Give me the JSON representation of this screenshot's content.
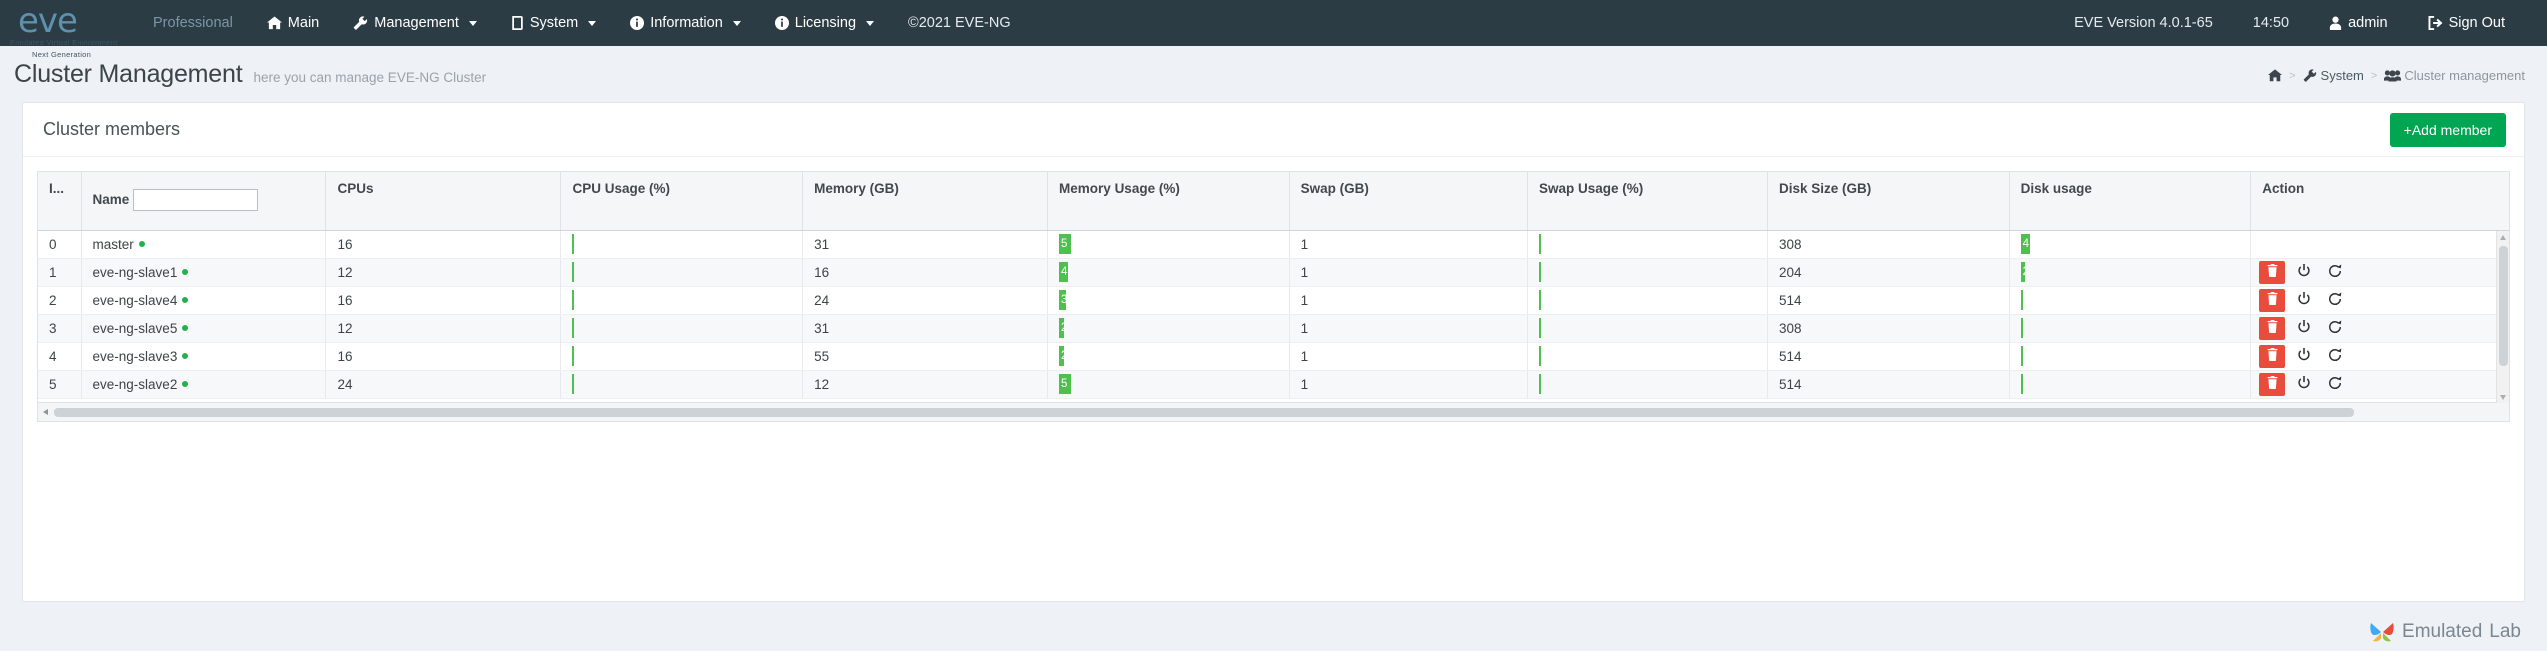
{
  "navbar": {
    "logo": {
      "text": "eve",
      "sub1": "Emulated Virtual Environment",
      "sub2": "Next Generation"
    },
    "items": [
      {
        "label": "Professional",
        "icon": "",
        "caret": false,
        "muted": true
      },
      {
        "label": "Main",
        "icon": "home-icon",
        "caret": false,
        "muted": false
      },
      {
        "label": "Management",
        "icon": "wrench-icon",
        "caret": true,
        "muted": false
      },
      {
        "label": "System",
        "icon": "book-icon",
        "caret": true,
        "muted": false
      },
      {
        "label": "Information",
        "icon": "info-icon",
        "caret": true,
        "muted": false
      },
      {
        "label": "Licensing",
        "icon": "info-icon",
        "caret": true,
        "muted": false
      },
      {
        "label": "©2021 EVE-NG",
        "icon": "",
        "caret": false,
        "muted": false
      }
    ],
    "version": "EVE Version 4.0.1-65",
    "time": "14:50",
    "user": "admin",
    "signout": "Sign Out",
    "user_icon": "user-icon",
    "signout_icon": "sign-out-icon"
  },
  "page": {
    "title": "Cluster Management",
    "subtitle": "here you can manage EVE-NG Cluster",
    "breadcrumb": {
      "home_icon": "home-icon",
      "sep": ">",
      "system": "System",
      "system_icon": "wrench-icon",
      "current": "Cluster management",
      "current_icon": "users-icon"
    }
  },
  "card": {
    "title": "Cluster members",
    "add_button": "+Add member"
  },
  "table": {
    "columns": [
      "I...",
      "Name",
      "CPUs",
      "CPU Usage (%)",
      "Memory (GB)",
      "Memory Usage (%)",
      "Swap (GB)",
      "Swap Usage (%)",
      "Disk Size (GB)",
      "Disk usage",
      "Action"
    ],
    "name_filter_value": "",
    "name_filter_placeholder": "",
    "rows": [
      {
        "id": "0",
        "name": "master",
        "status": "online",
        "cpus": "16",
        "cpu_usage": "0",
        "cpu_usage_pct": 0.4,
        "memory": "31",
        "memory_usage": "5",
        "memory_usage_pct": 5,
        "swap": "1",
        "swap_usage": "0",
        "swap_usage_pct": 0,
        "disk_size": "308",
        "disk_usage": "4",
        "disk_usage_pct": 4,
        "actions": []
      },
      {
        "id": "1",
        "name": "eve-ng-slave1",
        "status": "online",
        "cpus": "12",
        "cpu_usage": "0",
        "cpu_usage_pct": 0.5,
        "memory": "16",
        "memory_usage": "4",
        "memory_usage_pct": 4,
        "swap": "1",
        "swap_usage": "0",
        "swap_usage_pct": 0,
        "disk_size": "204",
        "disk_usage": "2",
        "disk_usage_pct": 2,
        "actions": [
          "delete",
          "power",
          "reload"
        ]
      },
      {
        "id": "2",
        "name": "eve-ng-slave4",
        "status": "online",
        "cpus": "16",
        "cpu_usage": "0",
        "cpu_usage_pct": 0.4,
        "memory": "24",
        "memory_usage": "3",
        "memory_usage_pct": 3,
        "swap": "1",
        "swap_usage": "0",
        "swap_usage_pct": 0,
        "disk_size": "514",
        "disk_usage": "1",
        "disk_usage_pct": 1,
        "actions": [
          "delete",
          "power",
          "reload"
        ]
      },
      {
        "id": "3",
        "name": "eve-ng-slave5",
        "status": "online",
        "cpus": "12",
        "cpu_usage": "0",
        "cpu_usage_pct": 0.4,
        "memory": "31",
        "memory_usage": "2",
        "memory_usage_pct": 2,
        "swap": "1",
        "swap_usage": "0",
        "swap_usage_pct": 0,
        "disk_size": "308",
        "disk_usage": "1",
        "disk_usage_pct": 1,
        "actions": [
          "delete",
          "power",
          "reload"
        ]
      },
      {
        "id": "4",
        "name": "eve-ng-slave3",
        "status": "online",
        "cpus": "16",
        "cpu_usage": "0",
        "cpu_usage_pct": 0.4,
        "memory": "55",
        "memory_usage": "2",
        "memory_usage_pct": 2,
        "swap": "1",
        "swap_usage": "0",
        "swap_usage_pct": 0,
        "disk_size": "514",
        "disk_usage": "1",
        "disk_usage_pct": 1,
        "actions": [
          "delete",
          "power",
          "reload"
        ]
      },
      {
        "id": "5",
        "name": "eve-ng-slave2",
        "status": "online",
        "cpus": "24",
        "cpu_usage": "0",
        "cpu_usage_pct": 0.4,
        "memory": "12",
        "memory_usage": "5",
        "memory_usage_pct": 5,
        "swap": "1",
        "swap_usage": "0",
        "swap_usage_pct": 0,
        "disk_size": "514",
        "disk_usage": "1",
        "disk_usage_pct": 1,
        "actions": [
          "delete",
          "power",
          "reload"
        ]
      }
    ]
  },
  "watermark": {
    "part1": "Emulated",
    "part2": "Lab"
  },
  "colors": {
    "navbar_bg": "#2b3c44",
    "accent_green": "#00a651",
    "progress_green": "#4ec04e",
    "status_green": "#22b14c",
    "delete_red": "#e74c3c",
    "logo_blue": "#5d91ad"
  }
}
